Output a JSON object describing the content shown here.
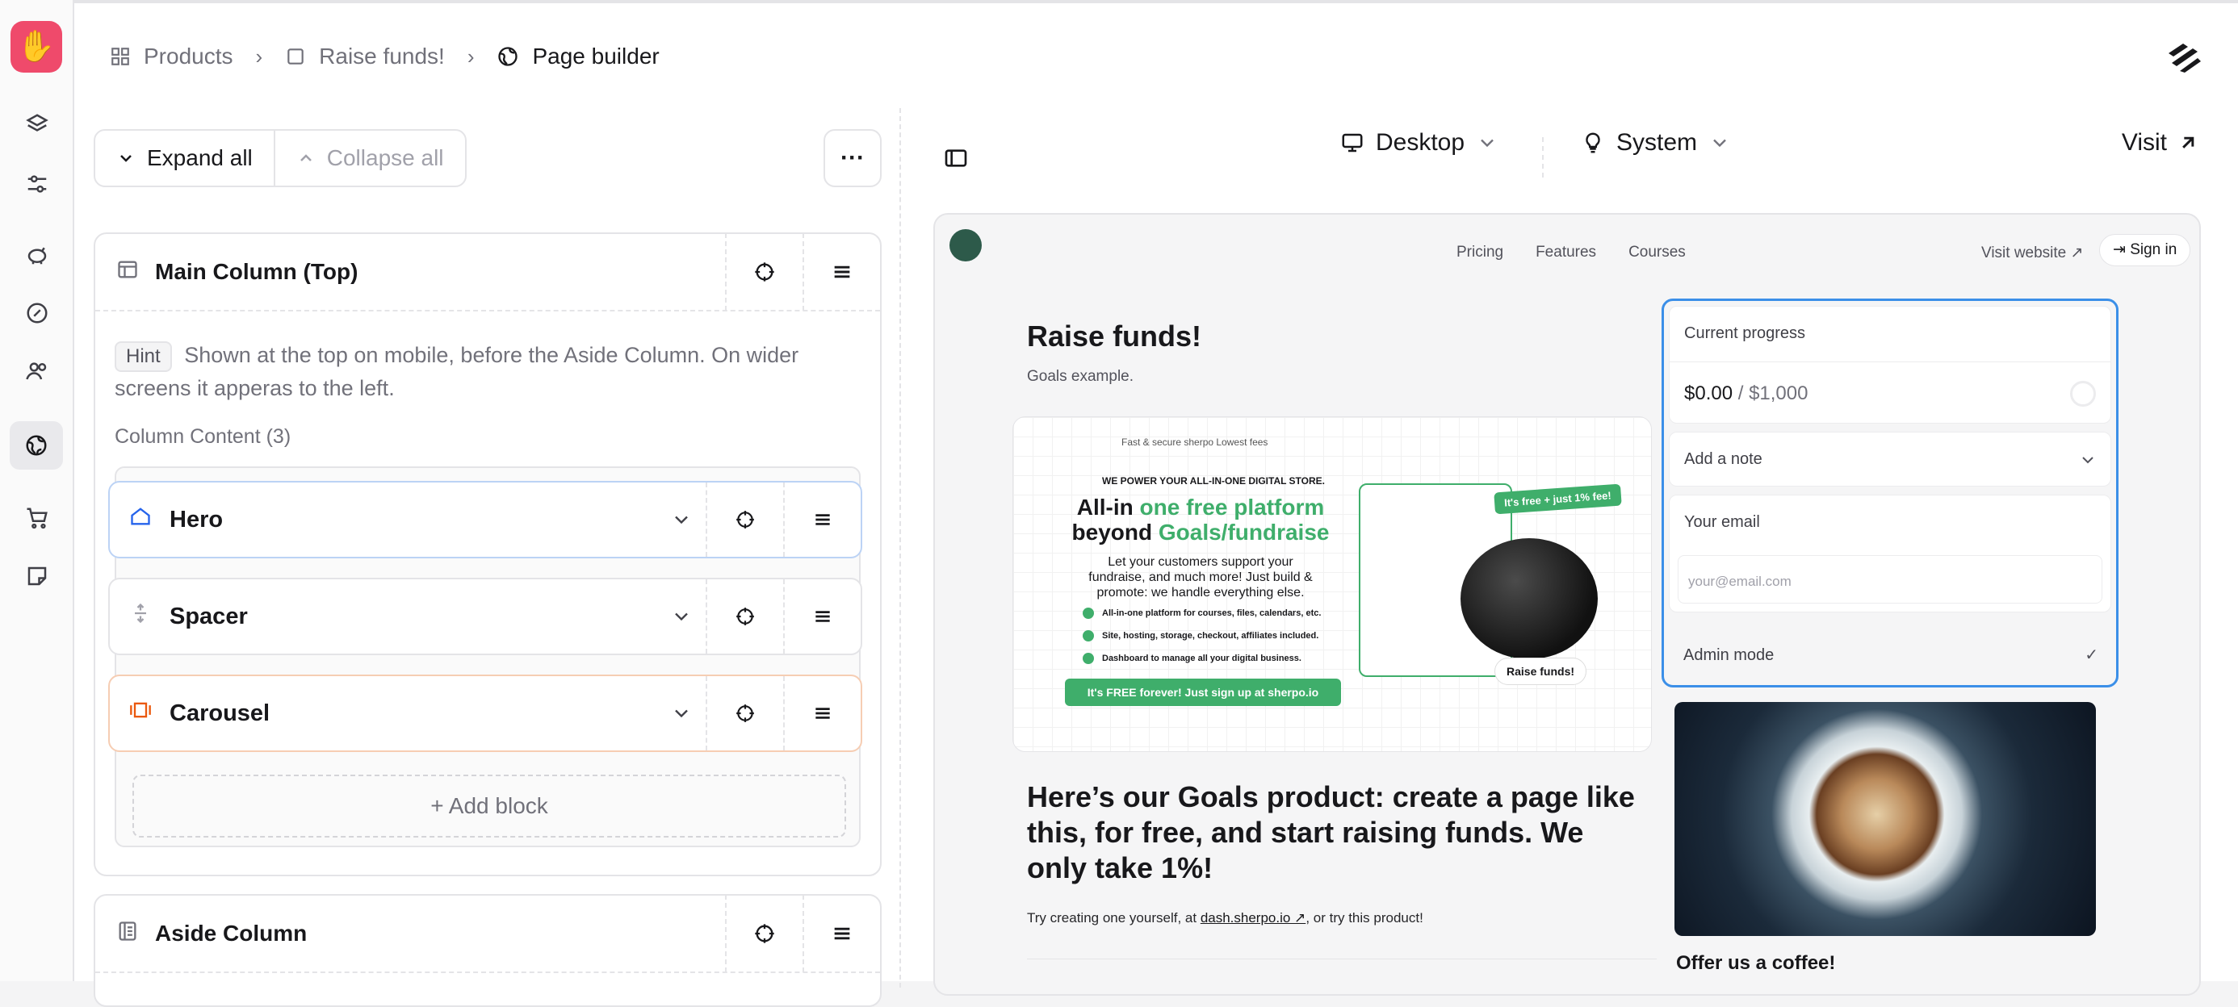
{
  "breadcrumb": {
    "items": [
      {
        "label": "Products",
        "icon": "grid-icon"
      },
      {
        "label": "Raise funds!",
        "icon": "square-icon"
      },
      {
        "label": "Page builder",
        "icon": "globe-icon"
      }
    ]
  },
  "rail": {
    "items": [
      "layers-icon",
      "sliders-icon",
      "piggy-bank-icon",
      "badge-icon",
      "users-icon",
      "globe-icon",
      "cart-icon",
      "note-icon"
    ],
    "active": "globe-icon",
    "brand_color": "#ef4a6b"
  },
  "toolbar": {
    "expand_label": "Expand all",
    "collapse_label": "Collapse all",
    "more_label": "···"
  },
  "main_column": {
    "title": "Main Column (Top)",
    "hint_tag": "Hint",
    "hint_text": "Shown at the top on mobile, before the Aside Column. On wider screens it apperas to the left.",
    "content_label": "Column Content (3)",
    "blocks": [
      {
        "label": "Hero",
        "icon": "home-icon",
        "accent": "#2563eb"
      },
      {
        "label": "Spacer",
        "icon": "spacer-icon",
        "accent": "#a1a1aa"
      },
      {
        "label": "Carousel",
        "icon": "carousel-icon",
        "accent": "#ea580c"
      }
    ],
    "add_block_label": "+ Add block"
  },
  "aside_column": {
    "title": "Aside Column"
  },
  "preview_toolbar": {
    "device": "Desktop",
    "theme": "System",
    "visit": "Visit"
  },
  "preview": {
    "nav": {
      "links": [
        "Pricing",
        "Features",
        "Courses"
      ],
      "visit_website": "Visit website ↗",
      "sign_in": "Sign in"
    },
    "title": "Raise funds!",
    "subtitle": "Goals example.",
    "promo": {
      "top": "Fast & secure    sherpo    Lowest fees",
      "kicker": "WE POWER YOUR ALL-IN-ONE DIGITAL STORE.",
      "headline_a": "All-in ",
      "headline_b": "one free platform",
      "headline_c": " beyond ",
      "headline_d": "Goals/fundraise",
      "para": "Let your customers support your fundraise, and much more! Just build & promote: we handle everything else.",
      "bullets": [
        "All-in-one platform for courses, files, calendars, etc.",
        "Site, hosting, storage, checkout, affiliates included.",
        "Dashboard to manage all your digital business."
      ],
      "cta": "It's FREE forever! Just sign up at sherpo.io",
      "fee": "It's free + just 1% fee!",
      "raise": "Raise funds!"
    },
    "headline": "Here’s our Goals product: create a page like this, for free, and start raising funds. We only take 1%!",
    "try_prefix": "Try creating one yourself, at ",
    "try_link": "dash.sherpo.io ↗",
    "try_suffix": ", or try this product!",
    "widget": {
      "progress_label": "Current progress",
      "progress_value": "$0.00",
      "progress_goal": " / $1,000",
      "note_label": "Add a note",
      "email_label": "Your email",
      "email_placeholder": "your@email.com",
      "admin_label": "Admin mode",
      "accent": "#3b8fe8"
    },
    "offer": "Offer us a coffee!"
  }
}
